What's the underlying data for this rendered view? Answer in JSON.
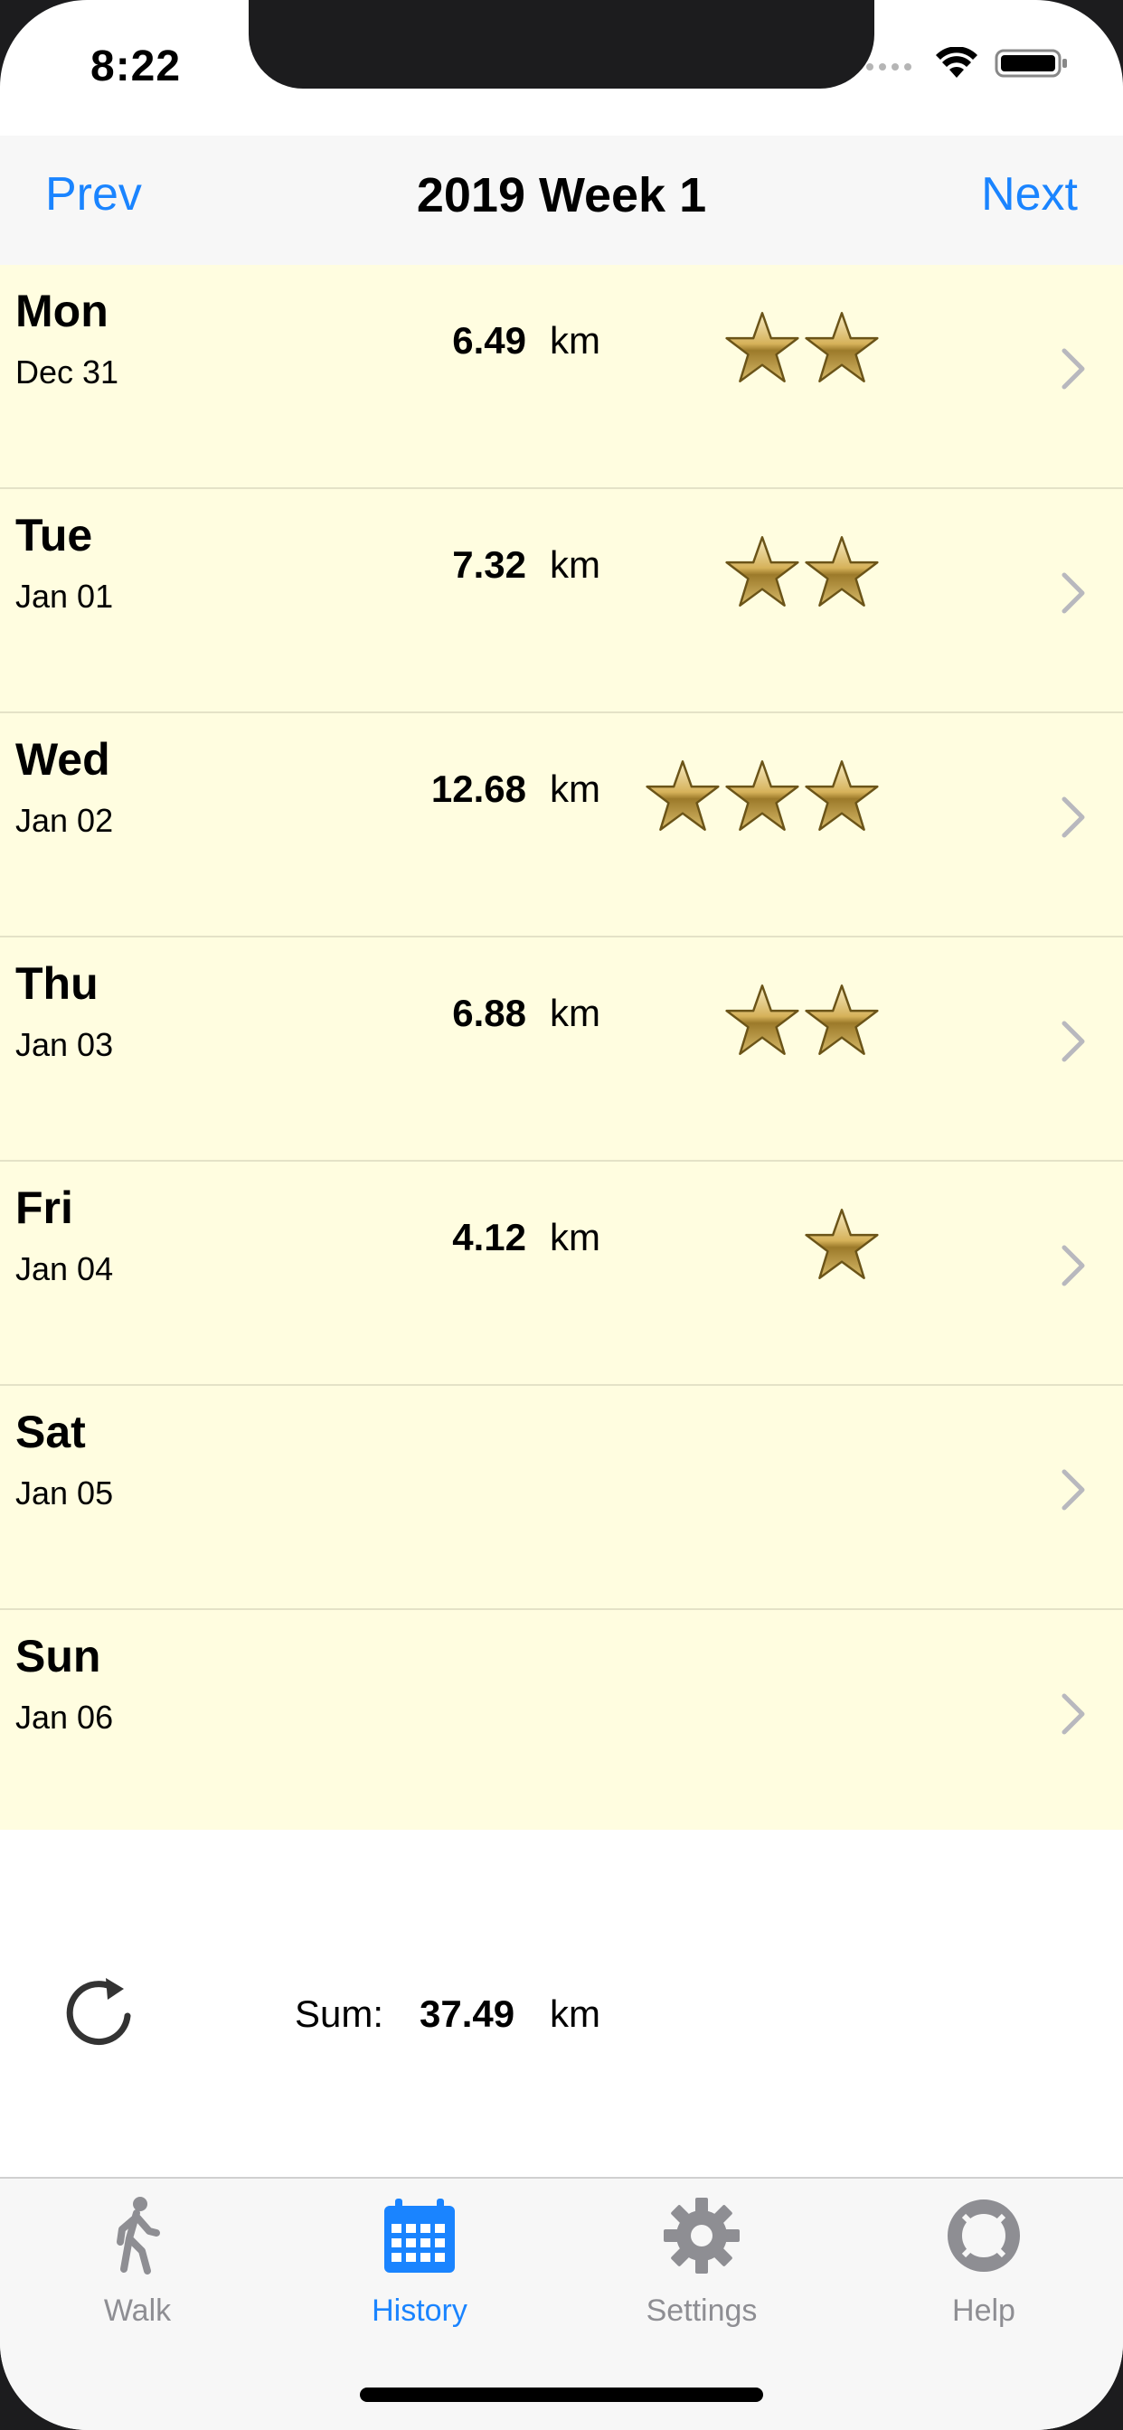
{
  "status_bar": {
    "time": "8:22"
  },
  "nav": {
    "prev_label": "Prev",
    "title": "2019 Week 1",
    "next_label": "Next"
  },
  "days": [
    {
      "day": "Mon",
      "date": "Dec 31",
      "distance": "6.49",
      "unit": "km",
      "stars": 2
    },
    {
      "day": "Tue",
      "date": "Jan 01",
      "distance": "7.32",
      "unit": "km",
      "stars": 2
    },
    {
      "day": "Wed",
      "date": "Jan 02",
      "distance": "12.68",
      "unit": "km",
      "stars": 3
    },
    {
      "day": "Thu",
      "date": "Jan 03",
      "distance": "6.88",
      "unit": "km",
      "stars": 2
    },
    {
      "day": "Fri",
      "date": "Jan 04",
      "distance": "4.12",
      "unit": "km",
      "stars": 1
    },
    {
      "day": "Sat",
      "date": "Jan 05",
      "distance": "",
      "unit": "",
      "stars": 0
    },
    {
      "day": "Sun",
      "date": "Jan 06",
      "distance": "",
      "unit": "",
      "stars": 0
    }
  ],
  "footer": {
    "sum_label": "Sum:",
    "sum_value": "37.49",
    "sum_unit": "km",
    "refresh_icon": "refresh-icon"
  },
  "tabs": [
    {
      "label": "Walk",
      "icon": "walk-icon",
      "active": false
    },
    {
      "label": "History",
      "icon": "calendar-icon",
      "active": true
    },
    {
      "label": "Settings",
      "icon": "gear-icon",
      "active": false
    },
    {
      "label": "Help",
      "icon": "lifebuoy-icon",
      "active": false
    }
  ],
  "colors": {
    "accent": "#1a84ff",
    "row_bg": "#fffde0",
    "star_gold": "#c9a84a",
    "tab_inactive": "#8e8e93"
  }
}
